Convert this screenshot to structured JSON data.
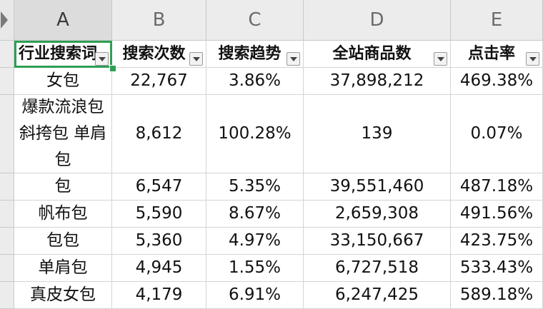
{
  "columns": [
    "A",
    "B",
    "C",
    "D",
    "E"
  ],
  "selected_column": "A",
  "header_row": [
    "行业搜索词",
    "搜索次数",
    "搜索趋势",
    "全站商品数",
    "点击率"
  ],
  "rows": [
    [
      "女包",
      "22,767",
      "3.86%",
      "37,898,212",
      "469.38%"
    ],
    [
      "爆款流浪包 斜挎包 单肩包",
      "8,612",
      "100.28%",
      "139",
      "0.07%"
    ],
    [
      "包",
      "6,547",
      "5.35%",
      "39,551,460",
      "487.18%"
    ],
    [
      "帆布包",
      "5,590",
      "8.67%",
      "2,659,308",
      "491.56%"
    ],
    [
      "包包",
      "5,360",
      "4.97%",
      "33,150,667",
      "423.75%"
    ],
    [
      "单肩包",
      "4,945",
      "1.55%",
      "6,727,518",
      "533.43%"
    ],
    [
      "真皮女包",
      "4,179",
      "6.91%",
      "6,247,425",
      "589.18%"
    ]
  ],
  "colors": {
    "selection": "#2f9e55",
    "header_bg": "#ececec"
  },
  "icons": {
    "filter": "filter-dropdown-icon",
    "select_all": "select-all-icon"
  }
}
